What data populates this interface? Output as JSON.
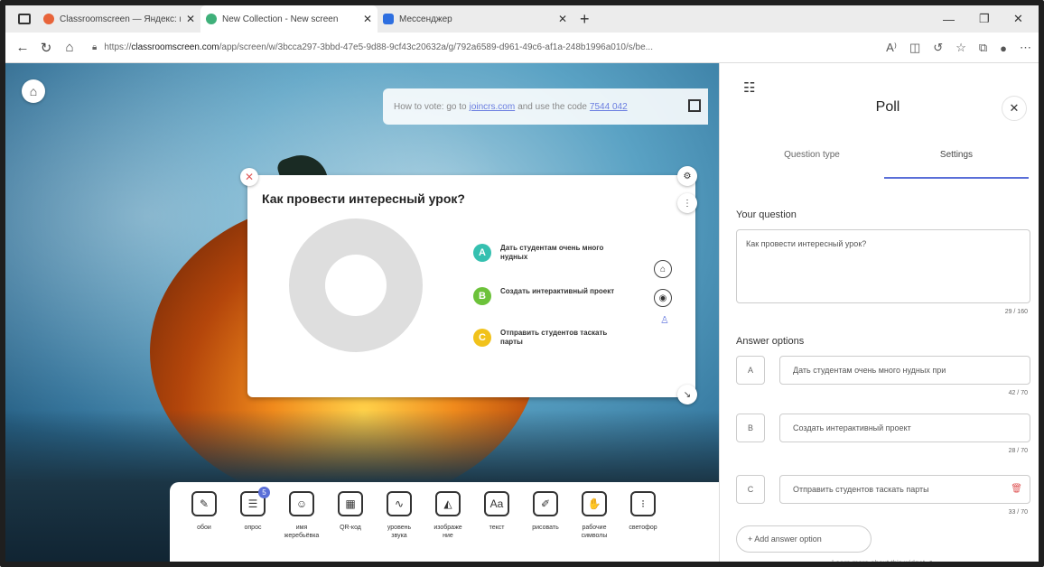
{
  "browser": {
    "tabs": [
      {
        "label": "Classroomscreen — Яндекс: на...",
        "color": "#e8643a",
        "active": false
      },
      {
        "label": "New Collection - New screen",
        "color": "#3fb07a",
        "active": true
      },
      {
        "label": "Мессенджер",
        "color": "#2e6fe0",
        "active": false
      }
    ],
    "url_prefix": "https://",
    "url_domain": "classroomscreen.com",
    "url_path": "/app/screen/w/3bcca297-3bbd-47e5-9d88-9cf43c20632a/g/792a6589-d961-49c6-af1a-248b1996a010/s/be...",
    "read_aloud": "A⁾"
  },
  "stage": {
    "vote_prefix": "How to vote: go to",
    "vote_site": "joincrs.com",
    "vote_middle": "and use the code",
    "vote_code": "7544 042"
  },
  "widget": {
    "title": "Как провести интересный урок?",
    "options": [
      {
        "letter": "A",
        "text": "Дать студентам очень много нудных",
        "color": "#35c0b0"
      },
      {
        "letter": "B",
        "text": "Создать интерактивный проект",
        "color": "#6cc23a"
      },
      {
        "letter": "C",
        "text": "Отправить студентов таскать парты",
        "color": "#f1c21b"
      }
    ]
  },
  "dock": {
    "items": [
      {
        "label": "обои",
        "icon": "✎"
      },
      {
        "label": "опрос",
        "icon": "☰",
        "badge": "5"
      },
      {
        "label": "имя\nжеребьёвка",
        "icon": "☺"
      },
      {
        "label": "QR-код",
        "icon": "▦"
      },
      {
        "label": "уровень\nзвука",
        "icon": "∿"
      },
      {
        "label": "изображе\nние",
        "icon": "◭"
      },
      {
        "label": "текст",
        "icon": "Aa"
      },
      {
        "label": "рисовать",
        "icon": "✐"
      },
      {
        "label": "рабочие\nсимволы",
        "icon": "✋"
      },
      {
        "label": "светофор",
        "icon": "⁝"
      }
    ]
  },
  "panel": {
    "title": "Poll",
    "tabs": [
      "Question type",
      "Settings"
    ],
    "question_label": "Your question",
    "question_value": "Как провести интересный урок?",
    "question_counter": "29 / 160",
    "answers_label": "Answer options",
    "answers": [
      {
        "letter": "A",
        "value": "Дать студентам очень много нудных при",
        "counter": "42 / 70"
      },
      {
        "letter": "B",
        "value": "Создать интерактивный проект",
        "counter": "28 / 70"
      },
      {
        "letter": "C",
        "value": "Отправить студентов таскать парты",
        "counter": "33 / 70"
      }
    ],
    "add_label": "+ Add answer option",
    "learn_more": "Learn more about this widget ↗"
  }
}
